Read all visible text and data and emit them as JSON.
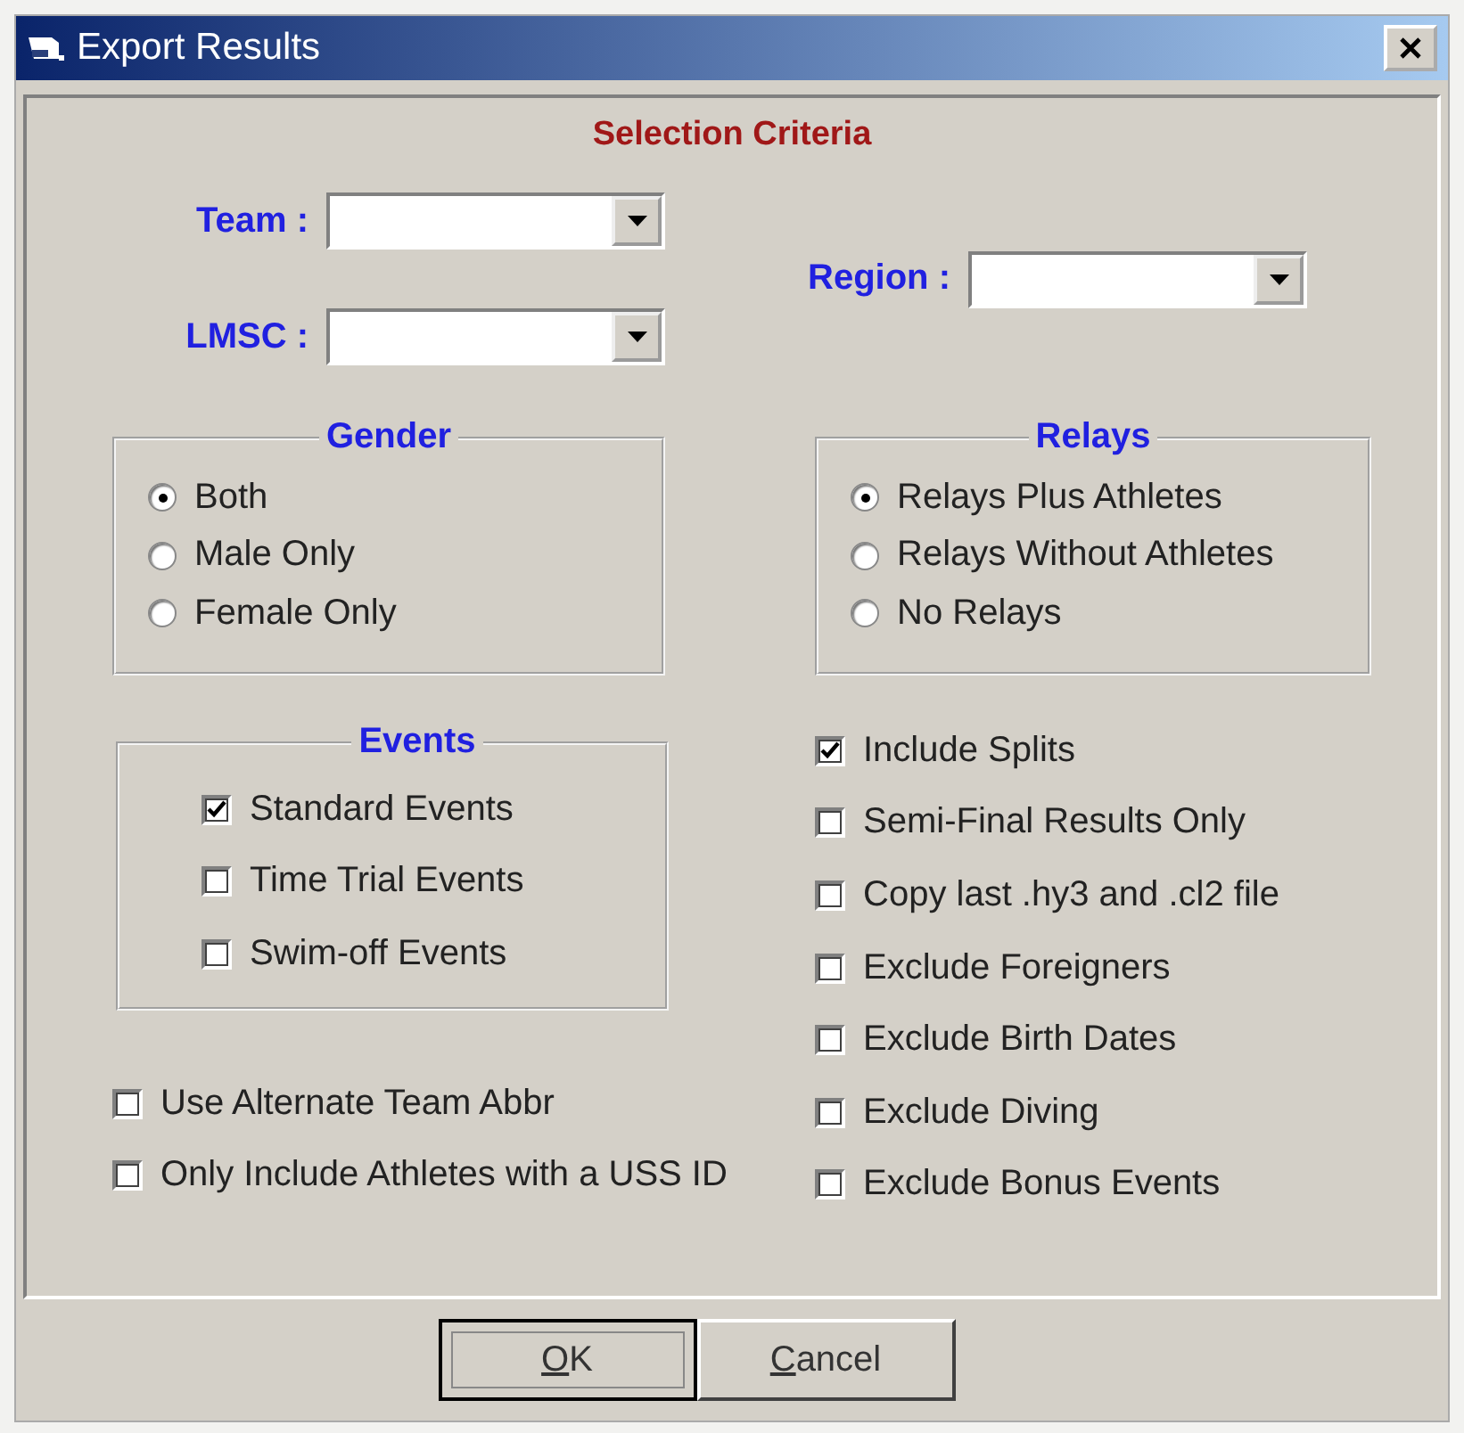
{
  "window": {
    "title": "Export Results"
  },
  "section_title": "Selection Criteria",
  "filters": [
    {
      "label": "Team :"
    },
    {
      "label": "LMSC :"
    },
    {
      "label": "Region :"
    }
  ],
  "gender": {
    "title": "Gender",
    "options": [
      {
        "label": "Both",
        "selected": true
      },
      {
        "label": "Male Only",
        "selected": false
      },
      {
        "label": "Female Only",
        "selected": false
      }
    ]
  },
  "relays": {
    "title": "Relays",
    "options": [
      {
        "label": "Relays Plus Athletes",
        "selected": true
      },
      {
        "label": "Relays Without Athletes",
        "selected": false
      },
      {
        "label": "No Relays",
        "selected": false
      }
    ]
  },
  "events": {
    "title": "Events",
    "options": [
      {
        "label": "Standard Events",
        "checked": true
      },
      {
        "label": "Time Trial Events",
        "checked": false
      },
      {
        "label": "Swim-off Events",
        "checked": false
      }
    ]
  },
  "left_options": [
    {
      "label": "Use Alternate Team Abbr",
      "checked": false
    },
    {
      "label": "Only Include Athletes with a USS ID",
      "checked": false
    }
  ],
  "right_options": [
    {
      "label": "Include Splits",
      "checked": true
    },
    {
      "label": "Semi-Final Results Only",
      "checked": false
    },
    {
      "label": "Copy last .hy3 and .cl2 file",
      "checked": false
    },
    {
      "label": "Exclude Foreigners",
      "checked": false
    },
    {
      "label": "Exclude Birth Dates",
      "checked": false
    },
    {
      "label": "Exclude Diving",
      "checked": false
    },
    {
      "label": "Exclude Bonus Events",
      "checked": false
    }
  ],
  "buttons": [
    {
      "label": "OK",
      "default": true
    },
    {
      "label": "Cancel",
      "default": false
    }
  ]
}
